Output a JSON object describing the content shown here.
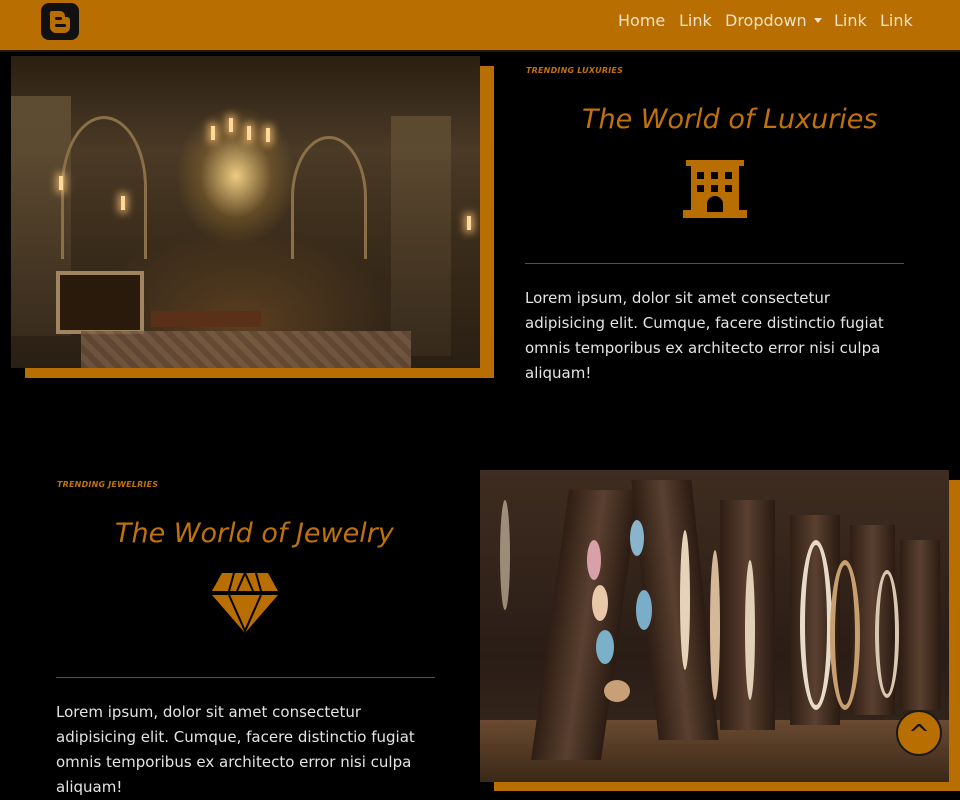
{
  "navbar": {
    "logo_icon": "blogger-icon",
    "links": [
      "Home",
      "Link",
      "Dropdown",
      "Link",
      "Link"
    ]
  },
  "sections": [
    {
      "label": "TRENDING LUXURIES",
      "title": "The World of Luxuries",
      "icon": "building-icon",
      "text": "Lorem ipsum, dolor sit amet consectetur adipisicing elit. Cumque, facere distinctio fugiat omnis temporibus ex architecto error nisi culpa aliquam!"
    },
    {
      "label": "TRENDING JEWELRIES",
      "title": "The World of Jewelry",
      "icon": "diamond-icon",
      "text": "Lorem ipsum, dolor sit amet consectetur adipisicing elit. Cumque, facere distinctio fugiat omnis temporibus ex architecto error nisi culpa aliquam!"
    }
  ],
  "back_to_top": "^",
  "colors": {
    "accent": "#b86e00",
    "background": "#000000",
    "text": "#e4e4e4"
  }
}
